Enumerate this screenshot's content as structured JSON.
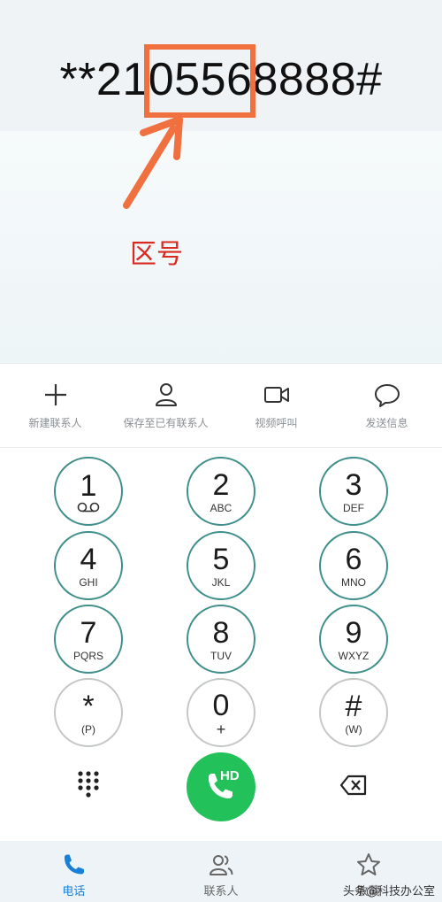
{
  "display": {
    "number": "**2105568888#"
  },
  "annotation": {
    "label": "区号",
    "label_color": "#d82a20",
    "highlight_color": "#f07040"
  },
  "actions": [
    {
      "label": "新建联系人",
      "icon": "plus-icon"
    },
    {
      "label": "保存至已有联系人",
      "icon": "person-icon"
    },
    {
      "label": "视频呼叫",
      "icon": "video-camera-icon"
    },
    {
      "label": "发送信息",
      "icon": "message-bubble-icon"
    }
  ],
  "keypad": {
    "keys": [
      {
        "digit": "1",
        "sub": "",
        "sub_icon": "voicemail-icon"
      },
      {
        "digit": "2",
        "sub": "ABC"
      },
      {
        "digit": "3",
        "sub": "DEF"
      },
      {
        "digit": "4",
        "sub": "GHI"
      },
      {
        "digit": "5",
        "sub": "JKL"
      },
      {
        "digit": "6",
        "sub": "MNO"
      },
      {
        "digit": "7",
        "sub": "PQRS"
      },
      {
        "digit": "8",
        "sub": "TUV"
      },
      {
        "digit": "9",
        "sub": "WXYZ"
      },
      {
        "digit": "*",
        "sub": "(P)"
      },
      {
        "digit": "0",
        "sub": "+"
      },
      {
        "digit": "#",
        "sub": "(W)"
      }
    ]
  },
  "controls": {
    "call_label": "HD",
    "call_color": "#22c15a",
    "left_icon": "dialpad-grid-icon",
    "right_icon": "backspace-icon"
  },
  "tabs": [
    {
      "label": "电话",
      "icon": "phone-icon",
      "active": true
    },
    {
      "label": "联系人",
      "icon": "contacts-icon",
      "active": false
    },
    {
      "label": "收藏",
      "icon": "star-icon",
      "active": false
    }
  ],
  "watermark": "头条@科技办公室"
}
